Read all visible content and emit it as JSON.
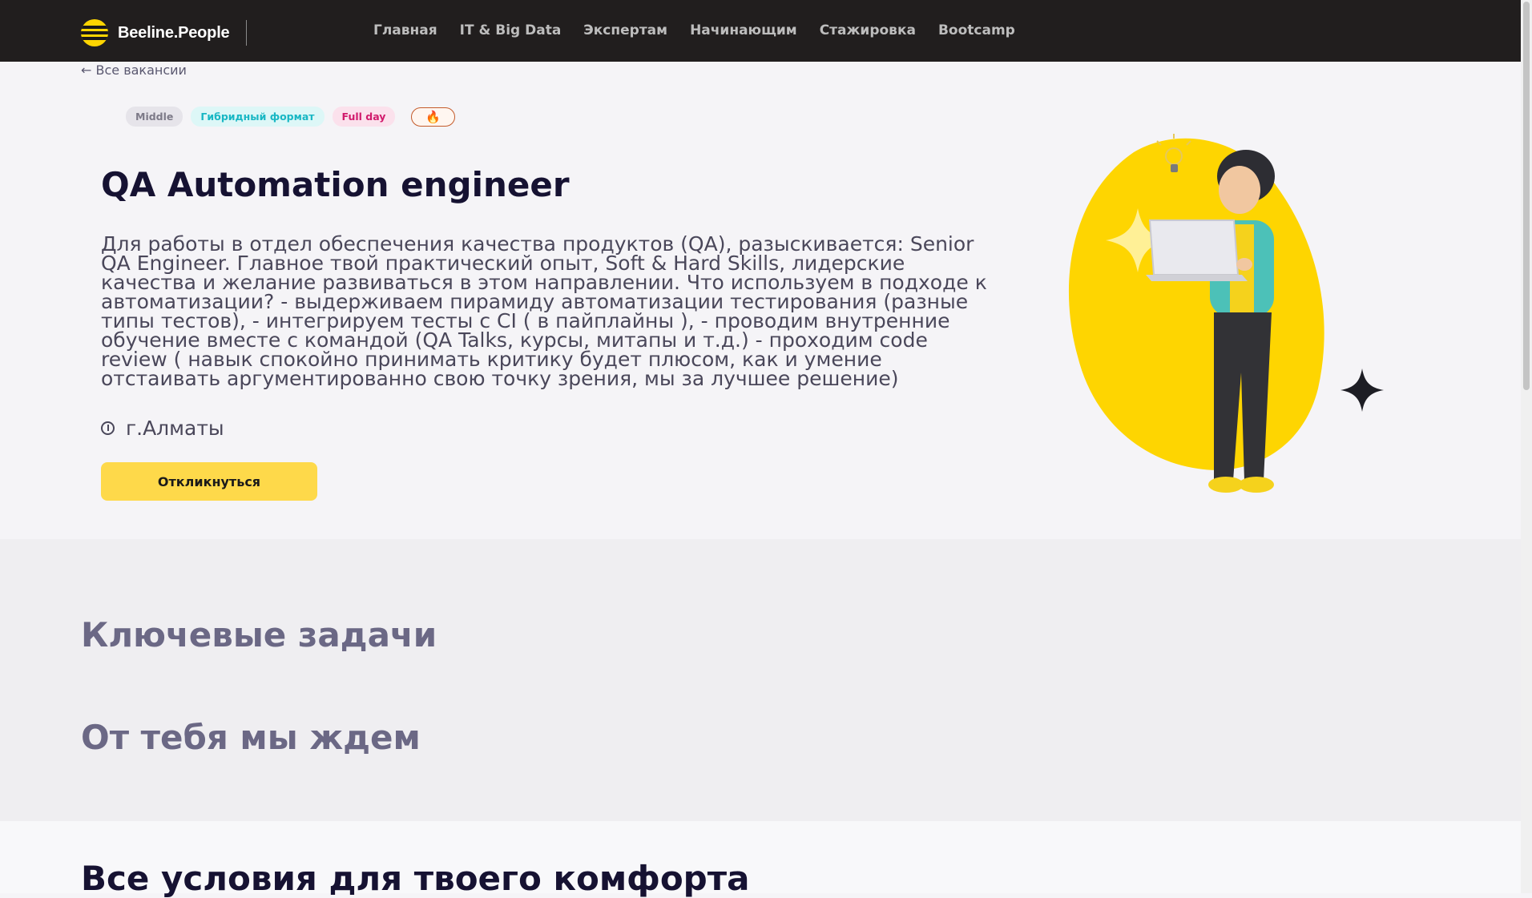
{
  "header": {
    "logo_text": "Beeline.People",
    "nav": [
      "Главная",
      "IT & Big Data",
      "Экспертам",
      "Начинающим",
      "Стажировка",
      "Bootcamp"
    ]
  },
  "back_link": "← Все вакансии",
  "tags": {
    "level": "Middle",
    "format": "Гибридный формат",
    "schedule": "Full day",
    "hot": "🔥"
  },
  "vacancy": {
    "title": "QA Automation engineer",
    "description": "Для работы в отдел обеспечения качества продуктов (QA), разыскивается: Senior QA Engineer. Главное твой практический опыт, Soft & Hard Skills, лидерские качества и желание развиваться в этом направлении.  Что используем в подходе к автоматизации? - выдерживаем пирамиду автоматизации тестирования (разные типы тестов), - интегрируем тесты с CI ( в пайплайны ), - проводим внутренние обучение вместе с командой (QA Talks, курсы, митапы и т.д.) - проходим code review ( навык спокойно принимать критику будет плюсом, как и умение отстаивать аргументированно свою точку зрения, мы за лучшее решение)",
    "location": "г.Алматы",
    "apply_label": "Откликнуться"
  },
  "sections": {
    "tasks": "Ключевые задачи",
    "expect": "От тебя мы ждем",
    "comfort": "Все условия для твоего комфорта"
  },
  "colors": {
    "accent": "#fed94a",
    "nav_bg": "#211e1e",
    "title": "#161232",
    "section_heading": "#6b6885"
  }
}
